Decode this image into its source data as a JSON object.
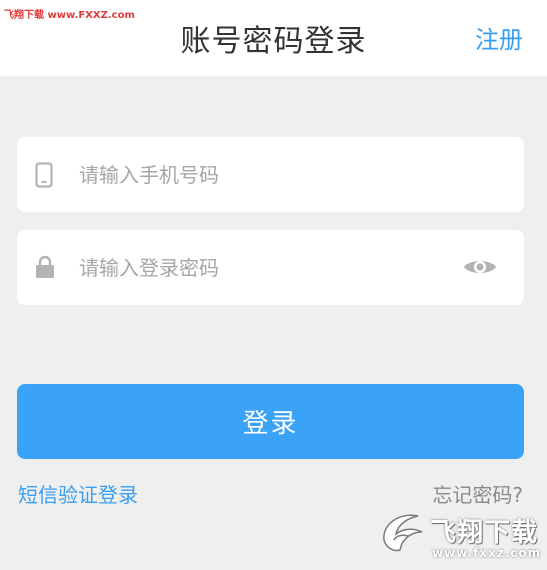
{
  "header": {
    "title": "账号密码登录",
    "register_label": "注册",
    "watermark_text": "飞翔下载 www.FXXZ.com"
  },
  "form": {
    "phone_placeholder": "请输入手机号码",
    "password_placeholder": "请输入登录密码",
    "login_label": "登录"
  },
  "links": {
    "sms_login": "短信验证登录",
    "forgot_password": "忘记密码?"
  },
  "watermark": {
    "brand": "飞翔下载",
    "url": "www.fxxz.com"
  },
  "colors": {
    "accent": "#3ba3f7",
    "link": "#3a9ef0",
    "background": "#efefef"
  },
  "icons": {
    "phone": "phone-icon",
    "lock": "lock-icon",
    "eye": "eye-icon"
  }
}
